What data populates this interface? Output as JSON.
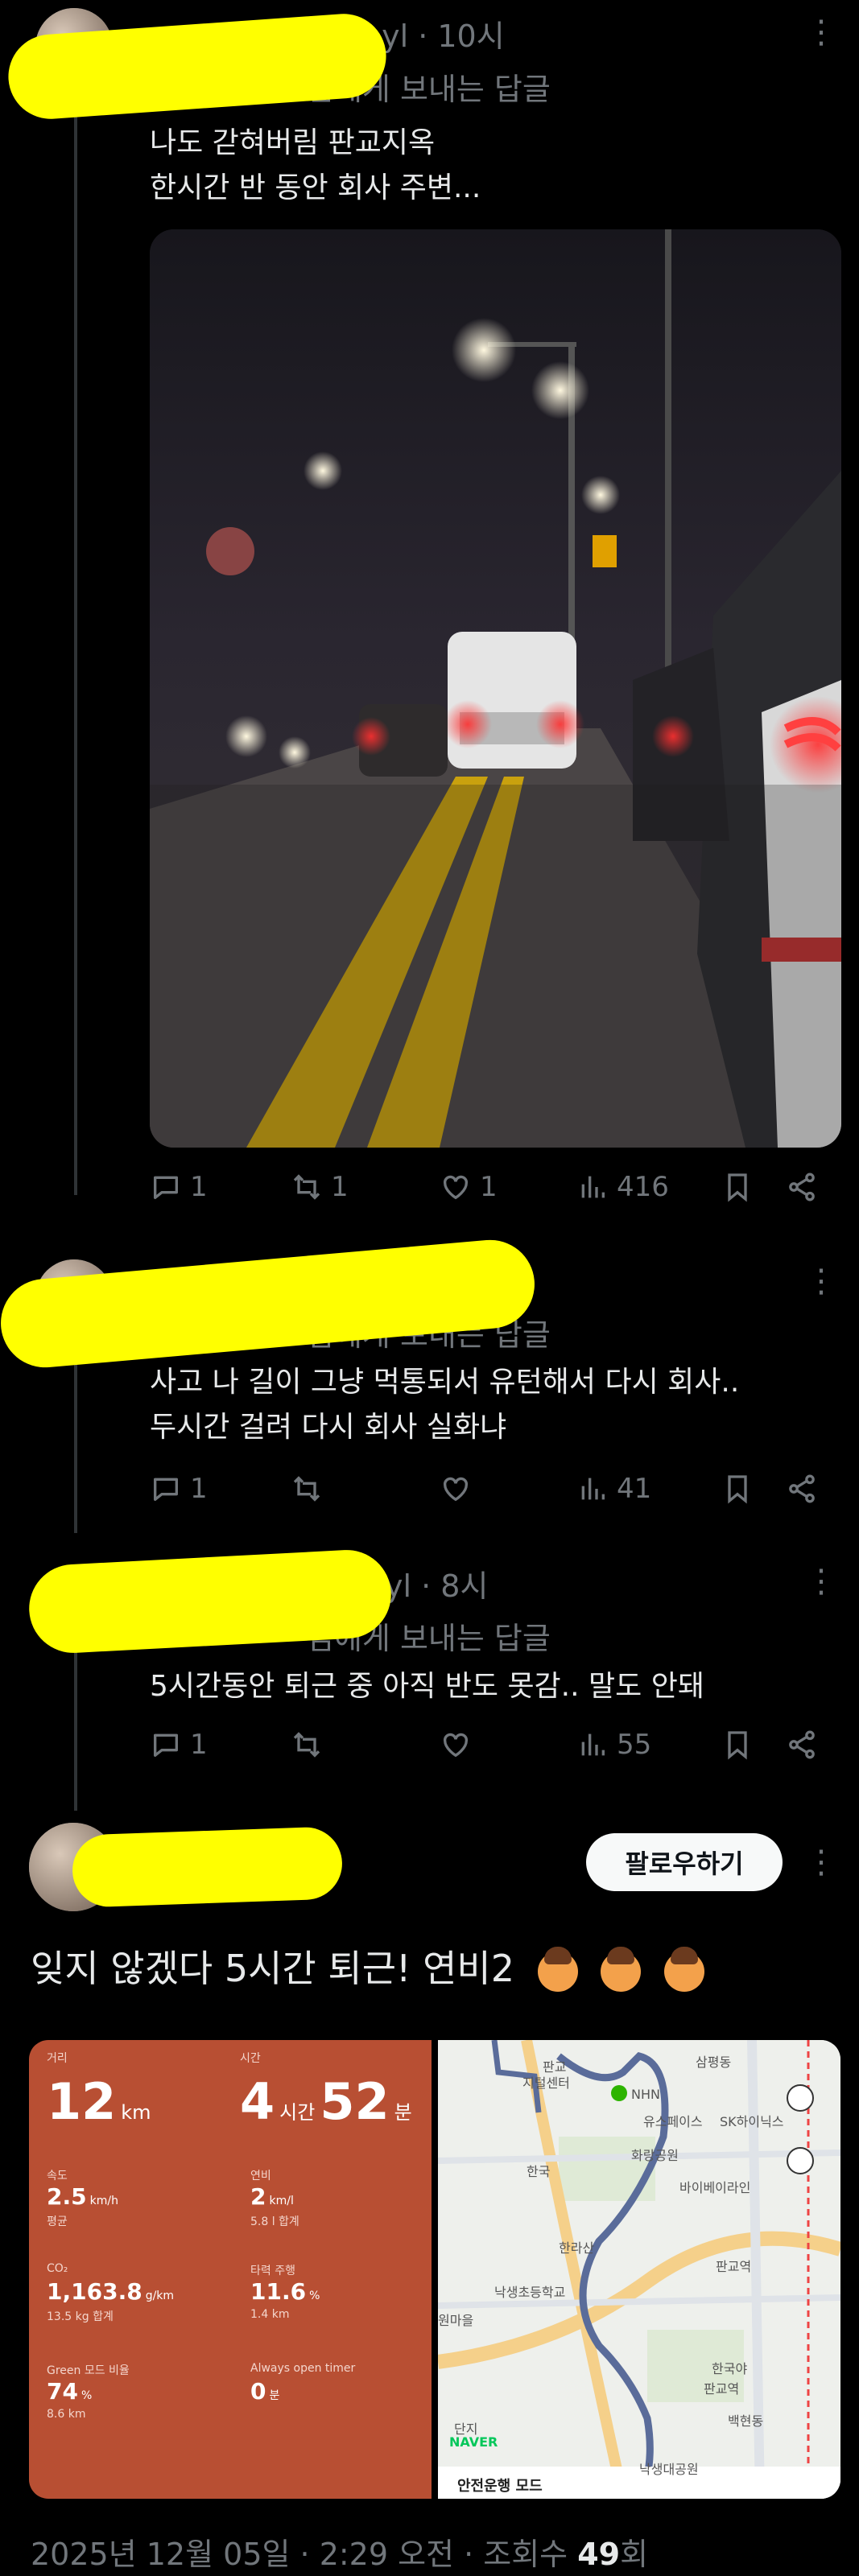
{
  "replies": [
    {
      "time_fragment": "nyl · 10시",
      "replying_to": "님에게 보내는 답글",
      "text": "나도 갇혀버림 판교지옥\n한시간 반 동안 회사 주변...",
      "actions": {
        "reply": "1",
        "repost": "1",
        "like": "1",
        "views": "416"
      }
    },
    {
      "time_fragment": "",
      "replying_to": "님에게 보내는 답글",
      "text": "사고 나 길이 그냥 먹통되서 유턴해서 다시 회사..\n두시간 걸려 다시 회사 실화냐",
      "actions": {
        "reply": "1",
        "repost": "",
        "like": "",
        "views": "41"
      }
    },
    {
      "time_fragment": "yl · 8시",
      "replying_to": "님에게 보내는 답글",
      "text": "5시간동안 퇴근 중 아직 반도 못감.. 말도 안돼",
      "actions": {
        "reply": "1",
        "repost": "",
        "like": "",
        "views": "55"
      }
    }
  ],
  "main_post": {
    "follow_label": "팔로우하기",
    "text": "잊지 않겠다 5시간 퇴근! 연비2",
    "emoji": "face-palm-emoji",
    "footer": {
      "date": "2025년 12월 05일 · 2:29 오전 · 조회수 ",
      "views": "49",
      "views_suffix": "회"
    }
  },
  "card": {
    "distance_label": "거리",
    "distance_value": "12",
    "distance_unit": "km",
    "time_label": "시간",
    "time_hours": "4",
    "time_hours_unit": "시간",
    "time_minutes": "52",
    "time_minutes_unit": "분",
    "speed_label": "속도",
    "speed_value": "2.5",
    "speed_unit": "km/h",
    "speed_sub": "평균",
    "fuel_label": "연비",
    "fuel_value": "2",
    "fuel_unit": "km/l",
    "fuel_sub": "5.8 l 합계",
    "co2_label": "CO₂",
    "co2_value": "1,163.8",
    "co2_unit": "g/km",
    "co2_sub": "13.5 kg 합계",
    "coast_label": "타력 주행",
    "coast_value": "11.6",
    "coast_unit": "%",
    "coast_sub": "1.4 km",
    "green_label": "Green 모드 비율",
    "green_value": "74",
    "green_unit": "%",
    "green_sub": "8.6 km",
    "timer_label": "Always open timer",
    "timer_value": "0",
    "timer_unit": "분"
  },
  "map": {
    "labels": [
      "판교",
      "삼평동",
      "지털센터",
      "NHN",
      "유스페이스",
      "SK하이닉스",
      "한국",
      "화랑공원",
      "바이베이라인",
      "판교역",
      "낙생초등학교",
      "원마을",
      "한라산",
      "낙생대공원",
      "판교역",
      "백현동",
      "한국야",
      "단지"
    ],
    "brand": "NAVER",
    "mode_label": "안전운행 모드"
  },
  "colors": {
    "accent_card": "#b84f33",
    "scribble": "#ffff00",
    "background": "#000000"
  }
}
